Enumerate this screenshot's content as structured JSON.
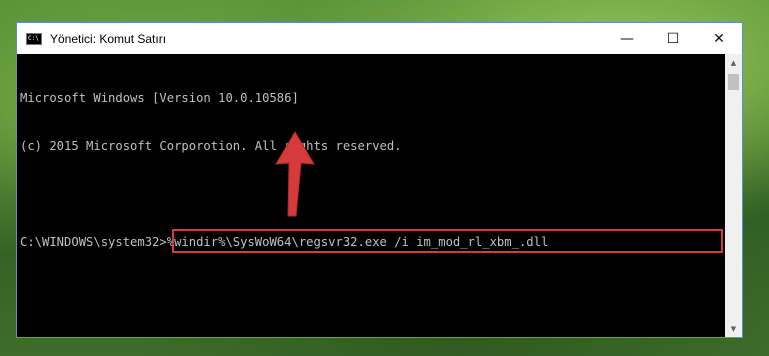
{
  "window": {
    "title": "Yönetici: Komut Satırı",
    "app_icon_text": "C:\\",
    "controls": {
      "minimize": "—",
      "maximize": "☐",
      "close": "✕"
    }
  },
  "console": {
    "lines": [
      "Microsoft Windows [Version 10.0.10586]",
      "(c) 2015 Microsoft Corporotion. All rights reserved."
    ],
    "prompt": "C:\\WINDOWS\\system32>",
    "command": "%windir%\\SysWoW64\\regsvr32.exe /i im_mod_rl_xbm_.dll"
  },
  "annotation": {
    "highlight_color": "#d63b3b",
    "arrow_color": "#d63b3b"
  },
  "scrollbar": {
    "up": "▲",
    "down": "▼"
  }
}
